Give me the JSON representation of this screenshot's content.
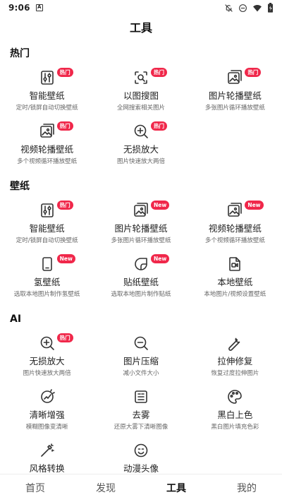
{
  "status": {
    "time": "9:06",
    "a_icon": "A"
  },
  "header": {
    "title": "工具"
  },
  "sections": [
    {
      "title": "热门",
      "items": [
        {
          "name": "智能壁纸",
          "desc": "定时/锁屏自动切换壁纸",
          "badge": "热门",
          "icon": "sliders-icon"
        },
        {
          "name": "以图搜图",
          "desc": "全网搜索相关图片",
          "badge": "热门",
          "icon": "image-search-icon"
        },
        {
          "name": "图片轮播壁纸",
          "desc": "多张图片循环播放壁纸",
          "badge": "热门",
          "icon": "image-stack-icon"
        },
        {
          "name": "视频轮播壁纸",
          "desc": "多个视频循环播放壁纸",
          "badge": "热门",
          "icon": "video-stack-icon"
        },
        {
          "name": "无损放大",
          "desc": "图片快速放大两倍",
          "badge": "热门",
          "icon": "zoom-in-icon"
        }
      ]
    },
    {
      "title": "壁纸",
      "items": [
        {
          "name": "智能壁纸",
          "desc": "定时/锁屏自动切换壁纸",
          "badge": "热门",
          "icon": "sliders-icon"
        },
        {
          "name": "图片轮播壁纸",
          "desc": "多张图片循环播放壁纸",
          "badge": "New",
          "icon": "image-stack-icon"
        },
        {
          "name": "视频轮播壁纸",
          "desc": "多个视频循环播放壁纸",
          "badge": "New",
          "icon": "video-stack-icon"
        },
        {
          "name": "氢壁纸",
          "desc": "选取本地图片制作氢壁纸",
          "badge": "New",
          "icon": "phone-icon"
        },
        {
          "name": "贴纸壁纸",
          "desc": "选取本地图片制作贴纸",
          "badge": "New",
          "icon": "sticker-icon"
        },
        {
          "name": "本地壁纸",
          "desc": "本地图片/视频设置壁纸",
          "badge": "",
          "icon": "local-video-icon"
        }
      ]
    },
    {
      "title": "AI",
      "items": [
        {
          "name": "无损放大",
          "desc": "图片快速放大两倍",
          "badge": "热门",
          "icon": "zoom-in-icon"
        },
        {
          "name": "图片压缩",
          "desc": "减小文件大小",
          "badge": "",
          "icon": "zoom-out-icon"
        },
        {
          "name": "拉伸修复",
          "desc": "恢复过度拉伸图片",
          "badge": "",
          "icon": "wrench-icon"
        },
        {
          "name": "清晰增强",
          "desc": "模糊图像变清晰",
          "badge": "",
          "icon": "enhance-icon"
        },
        {
          "name": "去雾",
          "desc": "还原大雾下清晰图像",
          "badge": "",
          "icon": "dehaze-icon"
        },
        {
          "name": "黑白上色",
          "desc": "黑白图片填充色彩",
          "badge": "",
          "icon": "palette-icon"
        },
        {
          "name": "风格转换",
          "desc": "",
          "badge": "",
          "icon": "magic-wand-icon"
        },
        {
          "name": "动漫头像",
          "desc": "",
          "badge": "",
          "icon": "emoji-icon"
        }
      ]
    }
  ],
  "nav": [
    {
      "label": "首页",
      "active": false
    },
    {
      "label": "发现",
      "active": false
    },
    {
      "label": "工具",
      "active": true
    },
    {
      "label": "我的",
      "active": false
    }
  ],
  "colors": {
    "badge": "#f0274a",
    "text": "#222222",
    "subtext": "#666666"
  }
}
